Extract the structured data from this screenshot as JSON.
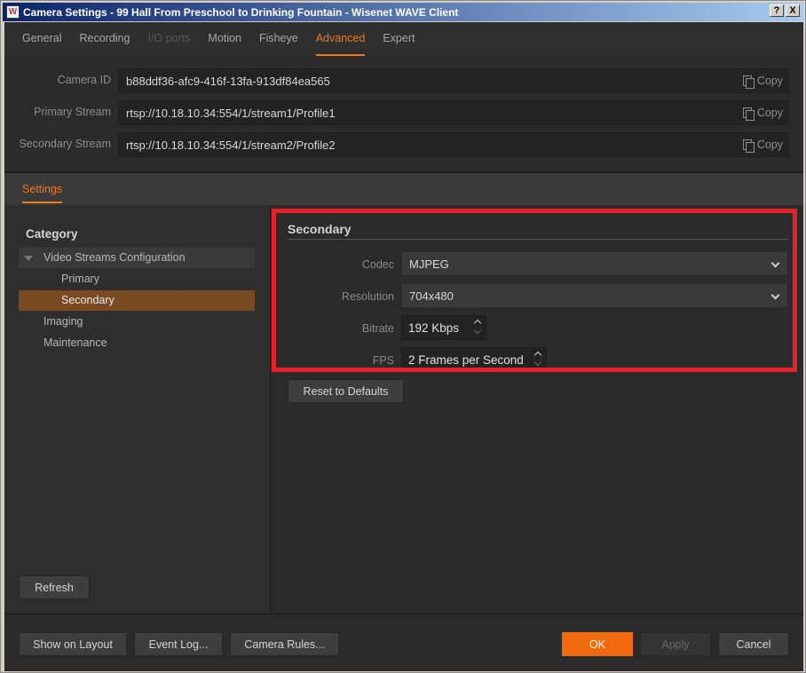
{
  "window": {
    "title": "Camera Settings - 99 Hall From Preschool to Drinking Fountain - Wisenet WAVE Client",
    "icon_letter": "W",
    "help_btn": "?",
    "close_btn": "X"
  },
  "tabs": [
    {
      "label": "General"
    },
    {
      "label": "Recording"
    },
    {
      "label": "I/O ports"
    },
    {
      "label": "Motion"
    },
    {
      "label": "Fisheye"
    },
    {
      "label": "Advanced"
    },
    {
      "label": "Expert"
    }
  ],
  "info": {
    "camera_id_label": "Camera ID",
    "camera_id_value": "b88ddf36-afc9-416f-13fa-913df84ea565",
    "primary_label": "Primary Stream",
    "primary_value": "rtsp://10.18.10.34:554/1/stream1/Profile1",
    "secondary_label": "Secondary Stream",
    "secondary_value": "rtsp://10.18.10.34:554/1/stream2/Profile2",
    "copy_label": "Copy"
  },
  "settings_tab": "Settings",
  "category": {
    "title": "Category",
    "items": [
      {
        "label": "Video Streams Configuration"
      },
      {
        "label": "Primary"
      },
      {
        "label": "Secondary"
      },
      {
        "label": "Imaging"
      },
      {
        "label": "Maintenance"
      }
    ],
    "refresh": "Refresh"
  },
  "secondary": {
    "title": "Secondary",
    "codec_label": "Codec",
    "codec_value": "MJPEG",
    "resolution_label": "Resolution",
    "resolution_value": "704x480",
    "bitrate_label": "Bitrate",
    "bitrate_value": "192 Kbps",
    "fps_label": "FPS",
    "fps_value": "2 Frames per Second",
    "reset": "Reset to Defaults"
  },
  "footer": {
    "show_on_layout": "Show on Layout",
    "event_log": "Event Log...",
    "camera_rules": "Camera Rules...",
    "ok": "OK",
    "apply": "Apply",
    "cancel": "Cancel"
  },
  "colors": {
    "accent": "#ef7a1a",
    "selection": "#7a4a22",
    "highlight_box": "#e8202a"
  }
}
